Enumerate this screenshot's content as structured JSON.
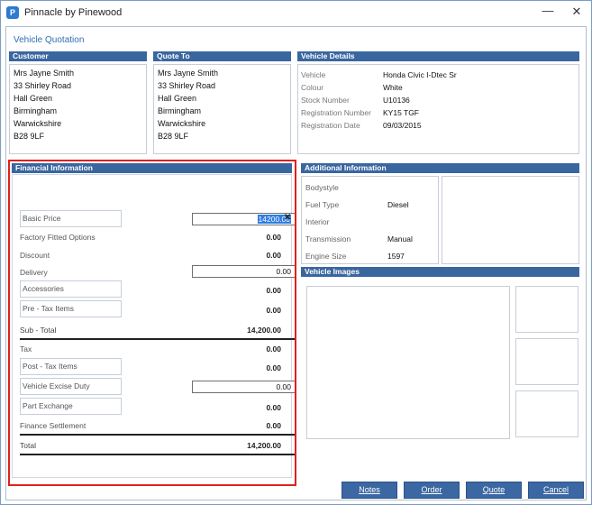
{
  "window": {
    "title": "Pinnacle by Pinewood",
    "minimize_symbol": "—",
    "close_symbol": "✕"
  },
  "form_title": "Vehicle Quotation",
  "customer": {
    "header": "Customer",
    "lines": [
      "Mrs Jayne Smith",
      "33 Shirley Road",
      "Hall Green",
      "Birmingham",
      "Warwickshire",
      "B28 9LF"
    ]
  },
  "quote_to": {
    "header": "Quote To",
    "lines": [
      "Mrs Jayne Smith",
      "33 Shirley Road",
      "Hall Green",
      "Birmingham",
      "Warwickshire",
      "B28 9LF"
    ]
  },
  "vehicle_details": {
    "header": "Vehicle Details",
    "rows": [
      {
        "label": "Vehicle",
        "value": "Honda Civic I-Dtec Sr"
      },
      {
        "label": "Colour",
        "value": "White"
      },
      {
        "label": "Stock Number",
        "value": "U10136"
      },
      {
        "label": "Registration Number",
        "value": "KY15 TGF"
      },
      {
        "label": "Registration Date",
        "value": "09/03/2015"
      }
    ]
  },
  "financial": {
    "header": "Financial Information",
    "basic_price": {
      "label": "Basic Price",
      "value": "14200.00",
      "clear_symbol": "✕"
    },
    "factory_fitted": {
      "label": "Factory Fitted Options",
      "value": "0.00"
    },
    "discount": {
      "label": "Discount",
      "value": "0.00"
    },
    "delivery": {
      "label": "Delivery",
      "value": "0.00"
    },
    "accessories": {
      "label": "Accessories",
      "value": "0.00"
    },
    "pre_tax": {
      "label": "Pre - Tax Items",
      "value": "0.00"
    },
    "subtotal": {
      "label": "Sub - Total",
      "value": "14,200.00"
    },
    "tax": {
      "label": "Tax",
      "value": "0.00"
    },
    "post_tax": {
      "label": "Post - Tax Items",
      "value": "0.00"
    },
    "excise": {
      "label": "Vehicle Excise Duty",
      "value": "0.00"
    },
    "part_exchange": {
      "label": "Part Exchange",
      "value": "0.00"
    },
    "finance_settlement": {
      "label": "Finance Settlement",
      "value": "0.00"
    },
    "total": {
      "label": "Total",
      "value": "14,200.00"
    }
  },
  "additional": {
    "header": "Additional Information",
    "rows": [
      {
        "label": "Bodystyle",
        "value": ""
      },
      {
        "label": "Fuel Type",
        "value": "Diesel"
      },
      {
        "label": "Interior",
        "value": ""
      },
      {
        "label": "Transmission",
        "value": "Manual"
      },
      {
        "label": "Engine Size",
        "value": "1597"
      }
    ]
  },
  "vehicle_images": {
    "header": "Vehicle Images"
  },
  "buttons": {
    "notes": "Notes",
    "order": "Order",
    "quote": "Quote",
    "cancel": "Cancel"
  },
  "colors": {
    "accent": "#3a66a0",
    "highlight_frame": "#e0201a",
    "selection": "#2f7de0"
  }
}
